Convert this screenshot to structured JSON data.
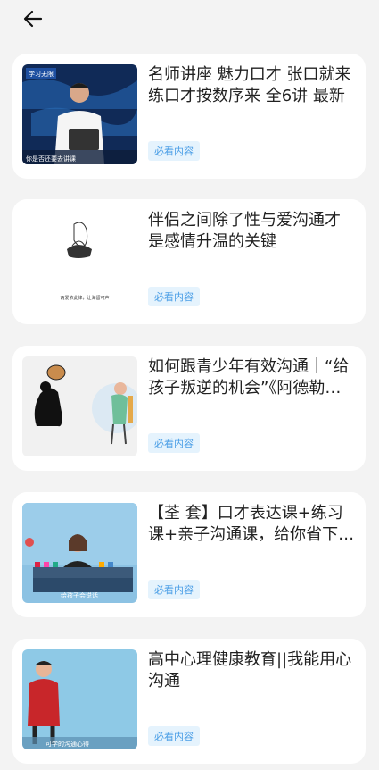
{
  "nav": {
    "back_icon": "arrow-left-icon"
  },
  "items": [
    {
      "title": "名师讲座 魅力口才 张口就来 练口才按数序来 全6讲 最新",
      "tag": "必看内容",
      "thumb_logo": "学习无限",
      "thumb_caption": "你是否还要去讲课"
    },
    {
      "title": "伴侣之间除了性与爱沟通才是感情升温的关键",
      "tag": "必看内容",
      "thumb_caption": "两爱依此律，让海留可声"
    },
    {
      "title": "如何跟青少年有效沟通｜“给孩子叛逆的机会”《阿德勒心理学》",
      "tag": "必看内容"
    },
    {
      "title": "【荃 套】口才表达课+练习课+亲子沟通课，给你省下几千元",
      "tag": "必看内容",
      "thumb_caption": "给孩子会说话"
    },
    {
      "title": "高中心理健康教育||我能用心沟通",
      "tag": "必看内容",
      "thumb_caption": "可学的沟通心得"
    }
  ]
}
